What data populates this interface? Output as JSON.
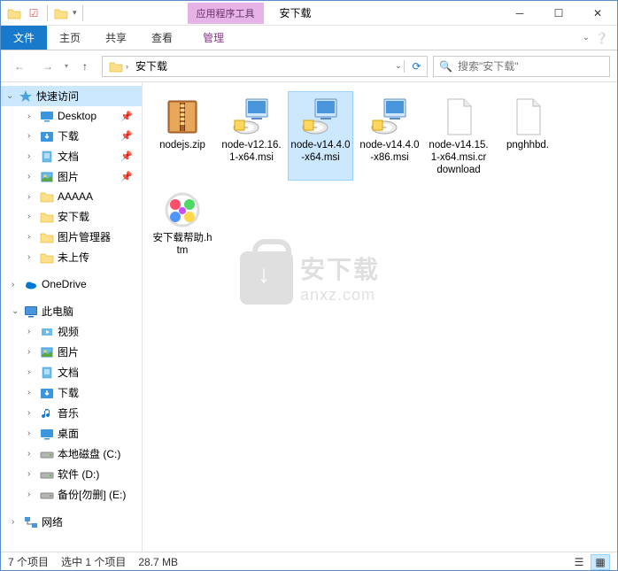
{
  "titlebar": {
    "context_tab": "应用程序工具",
    "window_title": "安下载"
  },
  "ribbon": {
    "file": "文件",
    "home": "主页",
    "share": "共享",
    "view": "查看",
    "manage": "管理"
  },
  "address": {
    "path_label": "安下载",
    "search_placeholder": "搜索\"安下载\""
  },
  "nav": {
    "quick_access": "快速访问",
    "items": [
      {
        "label": "Desktop",
        "icon": "desktop",
        "pinned": true
      },
      {
        "label": "下载",
        "icon": "download",
        "pinned": true
      },
      {
        "label": "文档",
        "icon": "docs",
        "pinned": true
      },
      {
        "label": "图片",
        "icon": "pictures",
        "pinned": true
      },
      {
        "label": "AAAAA",
        "icon": "folder",
        "pinned": false
      },
      {
        "label": "安下载",
        "icon": "folder",
        "pinned": false
      },
      {
        "label": "图片管理器",
        "icon": "folder",
        "pinned": false
      },
      {
        "label": "未上传",
        "icon": "folder",
        "pinned": false
      }
    ],
    "onedrive": "OneDrive",
    "thispc": "此电脑",
    "pc_items": [
      {
        "label": "视频",
        "icon": "videos"
      },
      {
        "label": "图片",
        "icon": "pictures"
      },
      {
        "label": "文档",
        "icon": "docs"
      },
      {
        "label": "下载",
        "icon": "download"
      },
      {
        "label": "音乐",
        "icon": "music"
      },
      {
        "label": "桌面",
        "icon": "desktop"
      },
      {
        "label": "本地磁盘 (C:)",
        "icon": "drive"
      },
      {
        "label": "软件 (D:)",
        "icon": "drive"
      },
      {
        "label": "备份[勿删] (E:)",
        "icon": "drive"
      }
    ],
    "network": "网络"
  },
  "files": [
    {
      "name": "nodejs.zip",
      "type": "zip",
      "selected": false
    },
    {
      "name": "node-v12.16.1-x64.msi",
      "type": "msi",
      "selected": false
    },
    {
      "name": "node-v14.4.0-x64.msi",
      "type": "msi",
      "selected": true
    },
    {
      "name": "node-v14.4.0-x86.msi",
      "type": "msi",
      "selected": false
    },
    {
      "name": "node-v14.15.1-x64.msi.crdownload",
      "type": "blank",
      "selected": false
    },
    {
      "name": "pnghhbd.",
      "type": "blank",
      "selected": false
    },
    {
      "name": "安下载帮助.htm",
      "type": "htm",
      "selected": false
    }
  ],
  "watermark": {
    "line1": "安下载",
    "line2": "anxz.com"
  },
  "status": {
    "count": "7 个项目",
    "selected": "选中 1 个项目",
    "size": "28.7 MB"
  }
}
